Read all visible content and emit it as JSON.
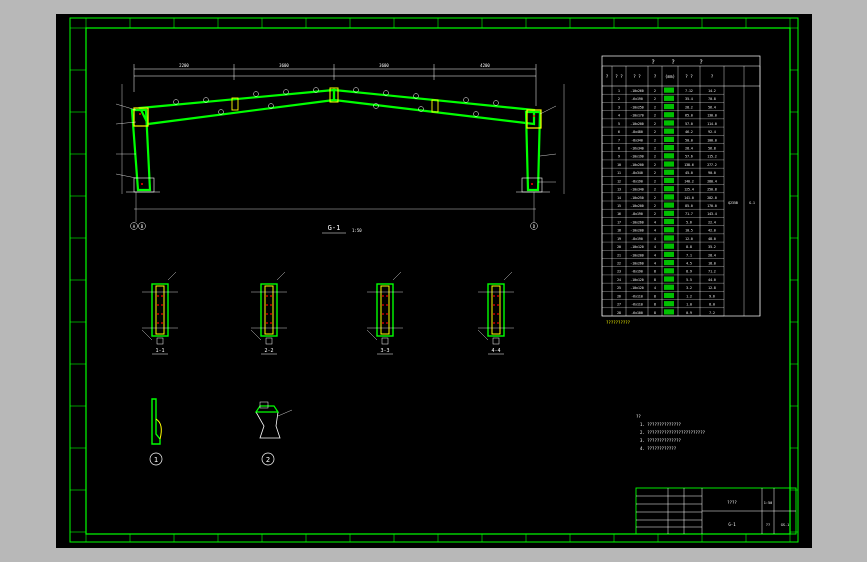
{
  "drawing": {
    "title_mark": "G-1",
    "title_scale": "1:50",
    "axis_left_a": "A",
    "axis_left_b": "B",
    "axis_right": "D",
    "section_labels": [
      "1-1",
      "2-2",
      "3-3",
      "4-4"
    ],
    "detail_labels": [
      "1",
      "2"
    ],
    "top_dimensions": [
      "2200",
      "3600",
      "3600",
      "4200"
    ],
    "colors": {
      "background": "#000000",
      "frame": "#00ff00",
      "steel": "#00ff00",
      "plate": "#ffff00",
      "dimension": "#ffffff",
      "bolt": "#ff0000"
    }
  },
  "material_table": {
    "header_top": [
      "?",
      "?",
      "?"
    ],
    "header_cols": [
      "?",
      "? ?",
      "? ?",
      "?",
      "(mm)",
      "? ?",
      "?"
    ],
    "rows": [
      [
        "1",
        "-10x260",
        "2",
        "7.12",
        "14.2"
      ],
      [
        "2",
        "-6x190",
        "2",
        "35.4",
        "70.8"
      ],
      [
        "3",
        "-10x250",
        "2",
        "28.2",
        "56.4"
      ],
      [
        "4",
        "-10x170",
        "2",
        "65.0",
        "130.0"
      ],
      [
        "5",
        "-10x200",
        "2",
        "57.0",
        "114.0"
      ],
      [
        "6",
        "-8x480",
        "2",
        "46.2",
        "92.4"
      ],
      [
        "7",
        "-8x340",
        "2",
        "50.0",
        "100.0"
      ],
      [
        "8",
        "-16x340",
        "2",
        "28.4",
        "56.8"
      ],
      [
        "9",
        "-10x190",
        "2",
        "57.6",
        "115.2"
      ],
      [
        "10",
        "-10x200",
        "2",
        "138.6",
        "277.2"
      ],
      [
        "11",
        "-8x340",
        "2",
        "45.0",
        "90.0"
      ],
      [
        "12",
        "-8x190",
        "2",
        "140.2",
        "280.4"
      ],
      [
        "13",
        "-10x340",
        "2",
        "125.4",
        "250.8"
      ],
      [
        "14",
        "-10x250",
        "2",
        "141.0",
        "282.0"
      ],
      [
        "15",
        "-10x200",
        "2",
        "85.0",
        "170.0"
      ],
      [
        "16",
        "-8x190",
        "2",
        "71.7",
        "143.4"
      ],
      [
        "17",
        "-10x260",
        "4",
        "5.6",
        "22.4"
      ],
      [
        "18",
        "-10x200",
        "4",
        "10.5",
        "42.0"
      ],
      [
        "19",
        "-8x190",
        "4",
        "12.0",
        "48.0"
      ],
      [
        "20",
        "-10x120",
        "4",
        "8.8",
        "35.2"
      ],
      [
        "21",
        "-10x200",
        "4",
        "7.1",
        "28.4"
      ],
      [
        "22",
        "-10x260",
        "4",
        "4.5",
        "18.0"
      ],
      [
        "23",
        "-8x190",
        "8",
        "8.9",
        "71.2"
      ],
      [
        "24",
        "-10x120",
        "8",
        "5.5",
        "44.0"
      ],
      [
        "25",
        "-10x120",
        "4",
        "3.2",
        "12.8"
      ],
      [
        "26",
        "-6x110",
        "8",
        "1.2",
        "9.6"
      ],
      [
        "27",
        "-6x110",
        "8",
        "1.0",
        "8.0"
      ],
      [
        "28",
        "-6x100",
        "8",
        "0.9",
        "7.2"
      ]
    ],
    "group_label": "Q235B",
    "group_mark": "G-1",
    "footnote": "??????????"
  },
  "notes": {
    "heading": "??",
    "lines": [
      "1. ??????????????",
      "2. ????????????????????????",
      "3. ??????????????",
      "4. ????????????"
    ]
  },
  "title_block": {
    "project": "????",
    "drawing_name": "G-1",
    "scale_label": "1:50",
    "sheet": "??",
    "number": "GS-1"
  }
}
